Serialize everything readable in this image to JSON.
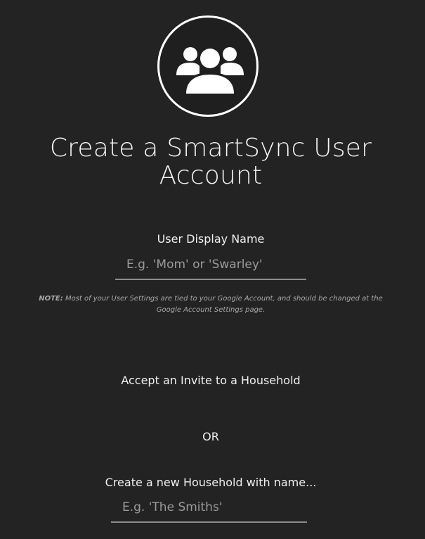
{
  "logo": {
    "icon": "users-group-icon"
  },
  "header": {
    "title_line1": "Create a SmartSync User",
    "title_line2": "Account"
  },
  "display_name": {
    "label": "User Display Name",
    "placeholder": "E.g. 'Mom' or 'Swarley'",
    "value": ""
  },
  "note": {
    "prefix": "NOTE:",
    "text": "Most of your User Settings are tied to your Google Account, and should be changed at the Google Account Settings page."
  },
  "household": {
    "accept_invite_label": "Accept an Invite to a Household",
    "or_label": "OR",
    "create_label": "Create a new Household with name...",
    "placeholder": "E.g. 'The Smiths'",
    "value": ""
  },
  "colors": {
    "background": "#232323",
    "text": "#f0f0f0",
    "placeholder": "#9a9a9a",
    "underline": "#8c8c8c"
  }
}
